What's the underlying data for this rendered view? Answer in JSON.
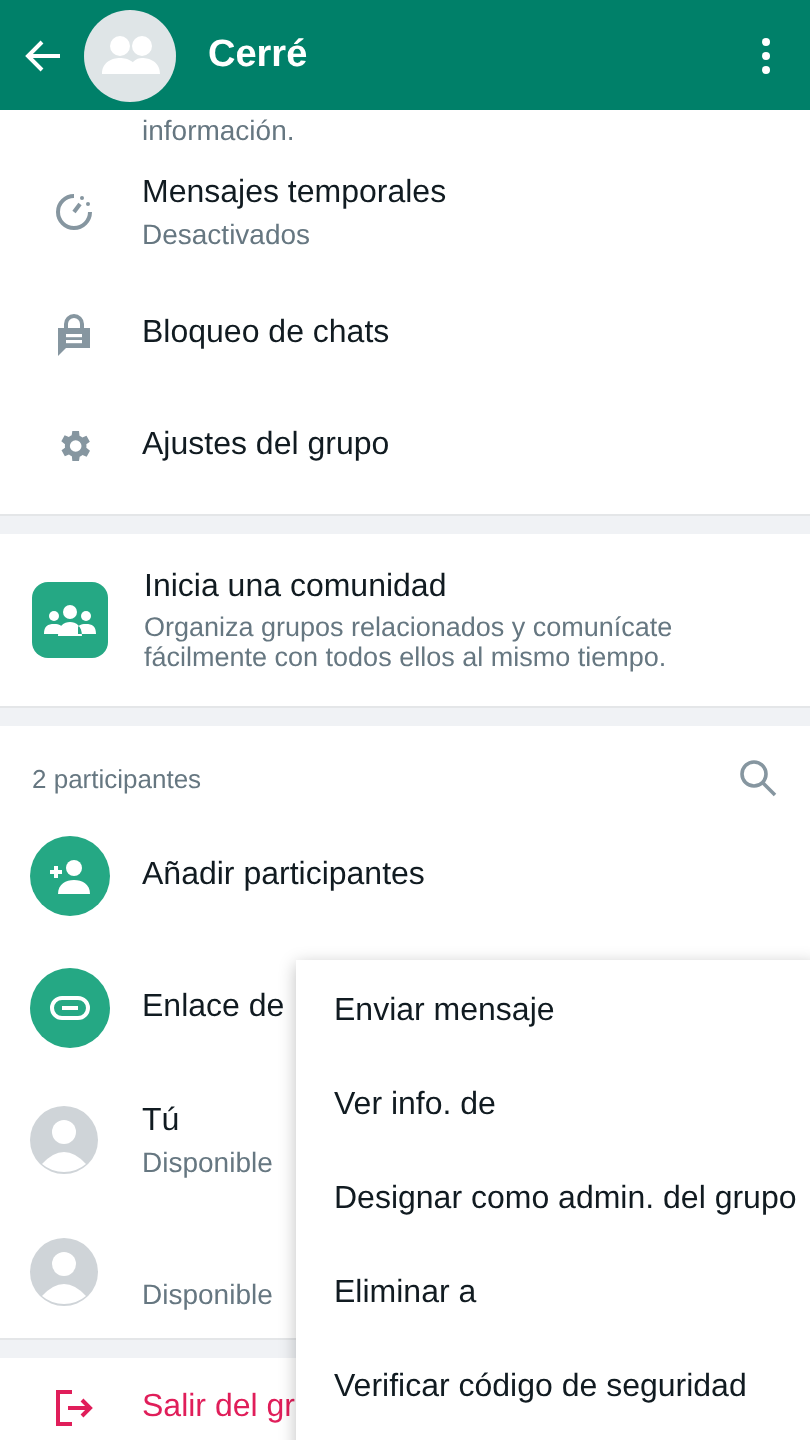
{
  "header": {
    "title": "Cerré"
  },
  "settings": [
    {
      "kind": "continuation",
      "title": "información."
    },
    {
      "kind": "timer",
      "title": "Mensajes temporales",
      "subtitle": "Desactivados"
    },
    {
      "kind": "lock",
      "title": "Bloqueo de chats"
    },
    {
      "kind": "gear",
      "title": "Ajustes del grupo"
    }
  ],
  "community": {
    "title": "Inicia una comunidad",
    "description": "Organiza grupos relacionados y comunícate fácilmente con todos ellos al mismo tiempo."
  },
  "participants": {
    "count": "2 participantes",
    "actions": [
      {
        "kind": "add",
        "label": "Añadir participantes"
      },
      {
        "kind": "link",
        "label": "Enlace de"
      }
    ],
    "members": [
      {
        "name": "Tú",
        "status": "Disponible"
      },
      {
        "status": "Disponible"
      }
    ]
  },
  "exit": {
    "label": "Salir del gr"
  },
  "menu": [
    "Enviar mensaje",
    "Ver info. de",
    "Designar como admin. del grupo",
    "Eliminar a",
    "Verificar código de seguridad"
  ]
}
